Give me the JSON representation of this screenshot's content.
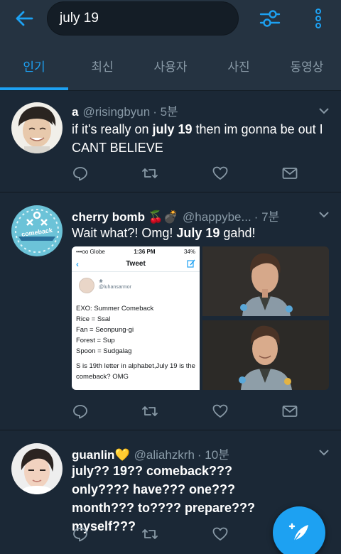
{
  "search": {
    "value": "july 19"
  },
  "tabs": [
    {
      "label": "인기",
      "active": true
    },
    {
      "label": "최신",
      "active": false
    },
    {
      "label": "사용자",
      "active": false
    },
    {
      "label": "사진",
      "active": false
    },
    {
      "label": "동영상",
      "active": false
    }
  ],
  "tweets": [
    {
      "name": "a",
      "handle": "@risingbyun",
      "time": "· 5분",
      "text_parts": [
        "if it's really on ",
        "july 19",
        " then im gonna be out I CANT BELIEVE"
      ]
    },
    {
      "name": "cherry bomb 🍒💣",
      "handle": "@happybe...",
      "time": "· 7분",
      "text_parts": [
        "Wait what?! Omg! ",
        "July 19",
        " gahd!"
      ],
      "avatar_text": "comeback",
      "embedded_screenshot": {
        "carrier": "•••oo Globe",
        "clock": "1:36 PM",
        "battery": "34%",
        "header": "Tweet",
        "username": "@luhansarmor",
        "lines": [
          "EXO: Summer Comeback",
          "Rice = Ssal",
          "Fan = Seonpung-gi",
          "Forest = Sup",
          "Spoon = Sudgalag",
          "",
          "S is 19th letter in alphabet,July 19 is the comeback? OMG"
        ]
      }
    },
    {
      "name": "guanlin💛",
      "handle": "@aliahzkrh",
      "time": "· 10분",
      "text_parts": [
        "july?? 19?? comeback??? only???? have??? one??? month??? to???? prepare??? myself???"
      ]
    }
  ],
  "colors": {
    "background": "#1b2836",
    "bar": "#253341",
    "accent": "#1da1f2",
    "muted": "#8899a6"
  }
}
